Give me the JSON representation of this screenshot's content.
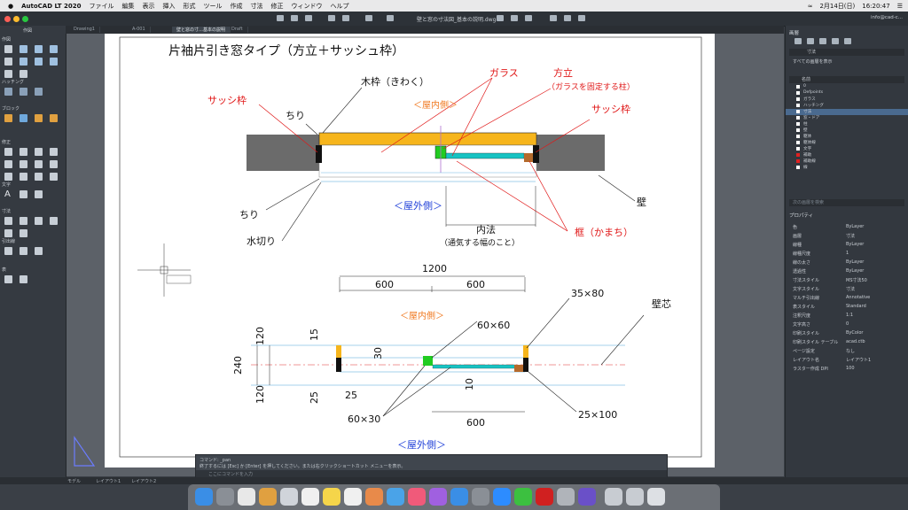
{
  "menubar": {
    "app": "AutoCAD LT 2020",
    "items": [
      "ファイル",
      "編集",
      "表示",
      "挿入",
      "形式",
      "ツール",
      "作成",
      "寸法",
      "修正",
      "ウィンドウ",
      "ヘルプ"
    ],
    "date": "2月14日(日)",
    "time": "16:20:47"
  },
  "titlebar": {
    "doc_title": "壁と窓の寸法図_基本の説明.dwg",
    "user": "info@cad-c..."
  },
  "tabs": [
    "Drawing1",
    "A-001",
    "壁と窓の寸…基本の説明",
    "Draft"
  ],
  "left_palette": {
    "title": "作図",
    "sections": [
      "作図",
      "ハッチング",
      "ブロック",
      "修正",
      "文字",
      "寸法",
      "引出線",
      "表"
    ]
  },
  "drawing": {
    "heading": "片袖片引き窓タイプ（方立＋サッシュ枠）",
    "labels": {
      "kiwaku": "木枠（きわく）",
      "glass": "ガラス",
      "houdate": "方立",
      "houdate_note": "（ガラスを固定する柱）",
      "sash_left": "サッシ枠",
      "sash_right": "サッシ枠",
      "chiri_top": "ちり",
      "indoor_top": "＜屋内側＞",
      "outdoor_top": "＜屋外側＞",
      "chiri_bottom": "ちり",
      "kabe": "壁",
      "mizukiri": "水切り",
      "uchinori": "内法",
      "uchinori_note": "（通気する幅のこと）",
      "kamachi": "框（かまち）",
      "indoor_bottom": "＜屋内側＞",
      "outdoor_bottom": "＜屋外側＞",
      "kabeshin": "壁芯"
    },
    "dims": {
      "total": "1200",
      "half_left": "600",
      "half_right": "600",
      "post": "60×60",
      "frame_corner": "35×80",
      "thick_total": "240",
      "thick_top": "120",
      "thick_bottom": "120",
      "d15": "15",
      "d30": "30",
      "d25a": "25",
      "d25b": "25",
      "d10": "10",
      "sash_small": "60×30",
      "bottom_600": "600",
      "kamachi_size": "25×100"
    }
  },
  "right_palette": {
    "layers_title": "画層",
    "current_layer": "寸法",
    "filter_label": "すべての画層を表示",
    "col_name": "名前",
    "layers": [
      {
        "name": "0",
        "color": "#ffffff"
      },
      {
        "name": "Defpoints",
        "color": "#ffffff"
      },
      {
        "name": "ガラス",
        "color": "#ffffff"
      },
      {
        "name": "ハッチング",
        "color": "#ffffff"
      },
      {
        "name": "寸法",
        "color": "#ffffff"
      },
      {
        "name": "窓・ドア",
        "color": "#ffffff"
      },
      {
        "name": "柱",
        "color": "#ffffff"
      },
      {
        "name": "壁",
        "color": "#ffffff"
      },
      {
        "name": "躯体",
        "color": "#ffffff"
      },
      {
        "name": "躯体線",
        "color": "#ffffff"
      },
      {
        "name": "文字",
        "color": "#ffffff"
      },
      {
        "name": "補助",
        "color": "#e02020"
      },
      {
        "name": "補助線",
        "color": "#e02020"
      },
      {
        "name": "線",
        "color": "#ffffff"
      }
    ],
    "search_placeholder": "次の画層を検索",
    "props_title": "プロパティ",
    "props": [
      {
        "k": "色",
        "v": "ByLayer"
      },
      {
        "k": "画層",
        "v": "寸法"
      },
      {
        "k": "線種",
        "v": "ByLayer"
      },
      {
        "k": "線種尺度",
        "v": "1"
      },
      {
        "k": "線の太さ",
        "v": "ByLayer"
      },
      {
        "k": "透過性",
        "v": "ByLayer"
      },
      {
        "k": "寸法スタイル",
        "v": "MS寸法50"
      },
      {
        "k": "文字スタイル",
        "v": "寸法"
      },
      {
        "k": "マルチ引出線",
        "v": "Annotative"
      },
      {
        "k": "表スタイル",
        "v": "Standard"
      },
      {
        "k": "注釈尺度",
        "v": "1:1"
      },
      {
        "k": "文字高さ",
        "v": "0"
      },
      {
        "k": "印刷スタイル",
        "v": "ByColor"
      },
      {
        "k": "印刷スタイル テーブル",
        "v": "acad.ctb"
      },
      {
        "k": "ページ設定",
        "v": "なし"
      },
      {
        "k": "レイアウト名",
        "v": "レイアウト1"
      },
      {
        "k": "ラスター作成 DPI",
        "v": "100"
      }
    ]
  },
  "command": {
    "line1": "コマンド: _pan",
    "line2": "終了するには [Esc] か [Enter] を押してください。または右クリックショートカット メニューを表示。",
    "placeholder": "ここにコマンドを入力"
  },
  "statusbar": {
    "tabs": [
      "モデル",
      "レイアウト1",
      "レイアウト2"
    ]
  }
}
